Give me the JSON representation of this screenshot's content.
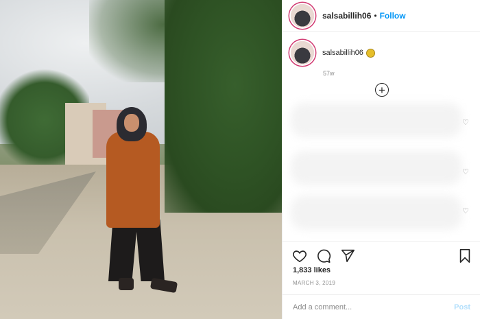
{
  "header": {
    "username": "salsabillih06",
    "separator": "•",
    "follow_label": "Follow",
    "more_label": "···"
  },
  "caption": {
    "username": "salsabillih06",
    "time": "57w"
  },
  "comments": {
    "count_visible": 3
  },
  "post": {
    "likes": "1,833 likes",
    "date": "MARCH 3, 2019"
  },
  "comment_box": {
    "placeholder": "Add a comment...",
    "post_label": "Post"
  },
  "colors": {
    "accent": "#0095f6",
    "post_disabled": "#b2dffc",
    "story_ring": "#d23d74"
  },
  "icons": [
    "heart-icon",
    "comment-icon",
    "share-icon",
    "bookmark-icon",
    "plus-circle-icon",
    "verified-badge-icon",
    "more-icon"
  ]
}
